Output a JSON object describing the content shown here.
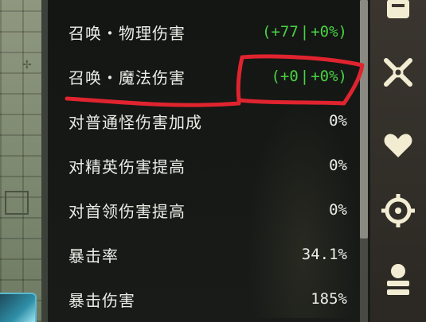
{
  "stats": [
    {
      "label": "召唤・物理伤害",
      "value_main": "(+77",
      "value_sep": "|",
      "value_pct": "+0%)",
      "green": true
    },
    {
      "label": "召唤・魔法伤害",
      "value_main": "(+0",
      "value_sep": "|",
      "value_pct": "+0%)",
      "green": true
    },
    {
      "label": "对普通怪伤害加成",
      "value": "0%"
    },
    {
      "label": "对精英伤害提高",
      "value": "0%"
    },
    {
      "label": "对首领伤害提高",
      "value": "0%"
    },
    {
      "label": "暴击率",
      "value": "34.1%"
    },
    {
      "label": "暴击伤害",
      "value": "185%"
    }
  ],
  "icons": {
    "top": "bag-icon",
    "second": "crossed-swords-icon",
    "third": "heart-icon",
    "fourth": "target-icon",
    "fifth": "character-icon"
  },
  "colors": {
    "value_green": "#49d244",
    "annotation_red": "#e0242f",
    "text": "#ecece6"
  }
}
